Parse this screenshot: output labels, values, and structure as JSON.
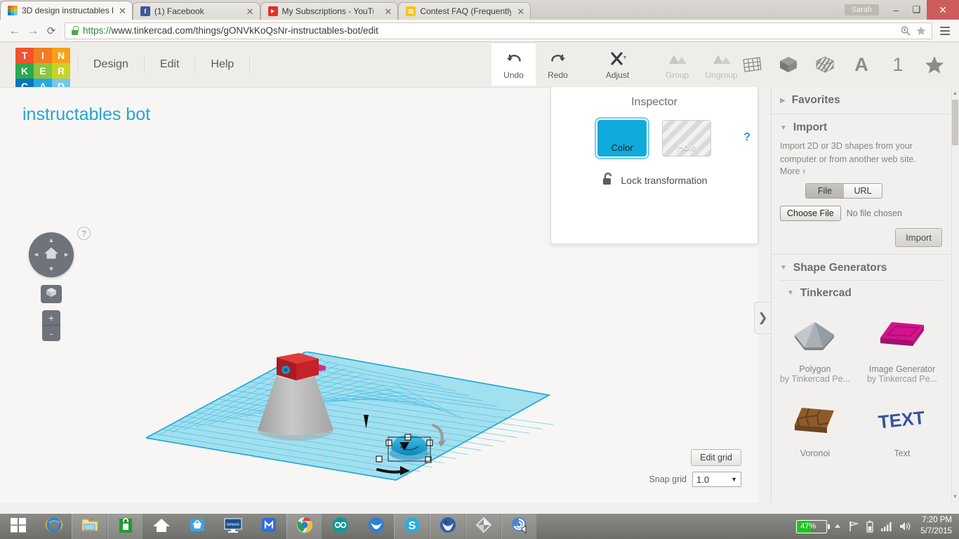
{
  "browser": {
    "tabs": [
      {
        "title": "3D design instructables b",
        "favicon": "tinkercad-icon",
        "active": true
      },
      {
        "title": "(1) Facebook",
        "favicon": "facebook-icon",
        "active": false
      },
      {
        "title": "My Subscriptions - YouTu",
        "favicon": "youtube-icon",
        "active": false
      },
      {
        "title": "Contest FAQ (Frequently ",
        "favicon": "contest-icon",
        "active": false
      }
    ],
    "user_chip": "Sarah",
    "window_controls": {
      "minimize": "–",
      "maximize": "❑",
      "close": "✕"
    },
    "url_scheme": "https://",
    "url_rest": "www.tinkercad.com/things/gONVkKoQsNr-instructables-bot/edit",
    "back_glyph": "←",
    "forward_glyph": "→",
    "reload_glyph": "⟳"
  },
  "app": {
    "logo_tiles": [
      {
        "letter": "T",
        "color": "#f4512c"
      },
      {
        "letter": "I",
        "color": "#f47c20"
      },
      {
        "letter": "N",
        "color": "#f7a11a"
      },
      {
        "letter": "K",
        "color": "#2aa94f"
      },
      {
        "letter": "E",
        "color": "#8cc63e"
      },
      {
        "letter": "R",
        "color": "#c8d322"
      },
      {
        "letter": "C",
        "color": "#0d74bd"
      },
      {
        "letter": "A",
        "color": "#29a9e0"
      },
      {
        "letter": "D",
        "color": "#74c8ef"
      }
    ],
    "menus": [
      "Design",
      "Edit",
      "Help"
    ],
    "tools": [
      {
        "label": "Undo",
        "icon": "undo-icon",
        "state": "active"
      },
      {
        "label": "Redo",
        "icon": "redo-icon",
        "state": "normal"
      },
      {
        "label": "Adjust",
        "icon": "adjust-icon",
        "state": "normal"
      },
      {
        "label": "Group",
        "icon": "group-icon",
        "state": "disabled"
      },
      {
        "label": "Ungroup",
        "icon": "ungroup-icon",
        "state": "disabled"
      }
    ],
    "right_icons": [
      "grid-icon",
      "solid-cube-icon",
      "striped-cube-icon",
      "text-a-icon",
      "number-one-icon",
      "star-icon"
    ],
    "design_title": "instructables bot",
    "help_badge": "?",
    "nav": {
      "home_icon": "home-icon",
      "up": "▲",
      "down": "▼",
      "left": "◄",
      "right": "►",
      "fit_icon": "fit-view-cube-icon",
      "zoom_in": "+",
      "zoom_out": "-"
    },
    "grid_controls": {
      "edit_grid_label": "Edit grid",
      "snap_grid_label": "Snap grid",
      "snap_grid_value": "1.0",
      "caret": "▼"
    },
    "colors": {
      "accent_cyan": "#27a3d6",
      "workplane_blue": "#6ed0ec",
      "inspector_color_swatch": "#0fa9dc",
      "body_grey": "#b9b9b9",
      "head_red": "#c0222a"
    }
  },
  "inspector": {
    "title": "Inspector",
    "color_label": "Color",
    "hole_label": "Hole",
    "lock_label": "Lock transformation",
    "lock_icon": "open-padlock-icon",
    "help": "?"
  },
  "sidebar": {
    "sections": [
      {
        "label": "Favorites",
        "tri": "▶",
        "expanded": false
      },
      {
        "label": "Import",
        "tri": "▼",
        "expanded": true
      },
      {
        "label": "Shape Generators",
        "tri": "▼",
        "expanded": true
      }
    ],
    "import": {
      "description": "Import 2D or 3D shapes from your computer or from another web site.",
      "more_label": "More ›",
      "seg_file": "File",
      "seg_url": "URL",
      "choose_file_label": "Choose File",
      "no_file_label": "No file chosen",
      "import_button": "Import"
    },
    "shape_generators": {
      "group_label": "Tinkercad",
      "group_tri": "▼",
      "shapes": [
        {
          "name": "Polygon",
          "author": "by Tinkercad Pe...",
          "color": "#9aa2a8",
          "icon": "polygon-shape-icon"
        },
        {
          "name": "Image Generator",
          "author": "by Tinkercad Pe...",
          "color": "#c2127e",
          "icon": "image-generator-shape-icon"
        },
        {
          "name": "Voronoi",
          "author": "",
          "color": "#8a5a2b",
          "icon": "voronoi-shape-icon"
        },
        {
          "name": "Text",
          "author": "",
          "color": "#2f4f9e",
          "icon": "text-shape-icon"
        }
      ]
    },
    "collapse_chevron": "❯",
    "scroll_up": "▲",
    "scroll_down": "▼"
  },
  "taskbar": {
    "left_items": [
      {
        "name": "start-button",
        "glyph": "windows-logo-icon",
        "boxed": false
      },
      {
        "name": "internet-explorer",
        "glyph": "ie-icon",
        "boxed": false
      },
      {
        "name": "file-explorer",
        "glyph": "folder-icon",
        "boxed": true
      },
      {
        "name": "windows-store",
        "glyph": "store-bag-icon",
        "boxed": true
      },
      {
        "name": "home-app",
        "glyph": "house-icon",
        "boxed": false
      },
      {
        "name": "blue-bag-app",
        "glyph": "blue-bag-icon",
        "boxed": false
      },
      {
        "name": "lenovo-app",
        "glyph": "lenovo-monitor-icon",
        "boxed": false
      },
      {
        "name": "maxthon-browser",
        "glyph": "maxthon-icon",
        "boxed": false
      },
      {
        "name": "chrome-browser",
        "glyph": "chrome-icon",
        "boxed": true
      },
      {
        "name": "arduino-ide",
        "glyph": "arduino-icon",
        "boxed": false
      },
      {
        "name": "bird-app",
        "glyph": "bird-icon",
        "boxed": false
      },
      {
        "name": "skype",
        "glyph": "skype-icon",
        "boxed": true
      },
      {
        "name": "thunderbird",
        "glyph": "thunderbird-icon",
        "boxed": true
      },
      {
        "name": "unity-editor",
        "glyph": "unity-icon",
        "boxed": true
      },
      {
        "name": "audio-app",
        "glyph": "audio-swirl-icon",
        "boxed": true
      }
    ],
    "battery_percent": "47%",
    "battery_level": 47,
    "tray_icons": [
      "show-hidden-icon",
      "action-flag-icon",
      "battery-icon",
      "signal-bars-icon",
      "volume-icon"
    ],
    "time": "7:20 PM",
    "date": "5/7/2015"
  }
}
